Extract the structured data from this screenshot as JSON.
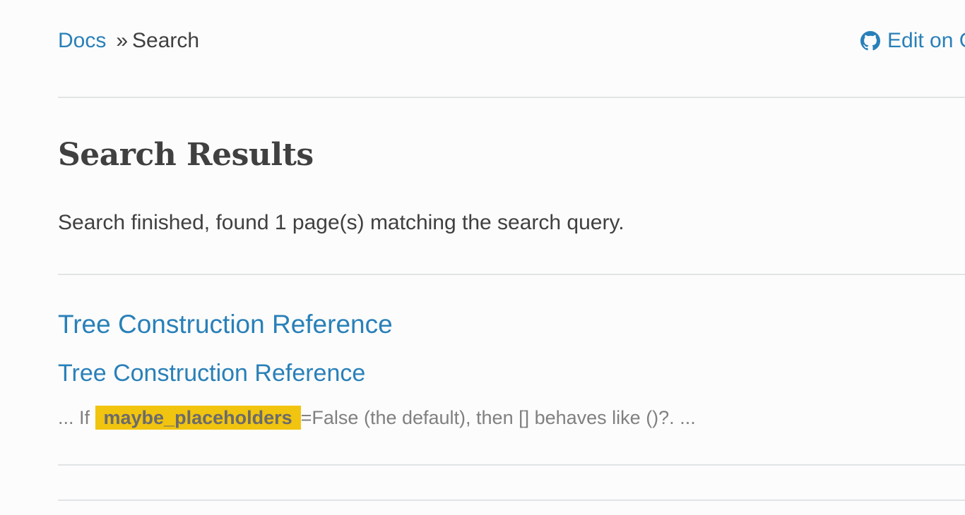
{
  "breadcrumb": {
    "root_label": "Docs",
    "separator": "»",
    "current": "Search"
  },
  "edit_link": {
    "label": "Edit on G",
    "icon": "github-icon"
  },
  "page": {
    "title": "Search Results",
    "summary": "Search finished, found 1 page(s) matching the search query."
  },
  "results": [
    {
      "title": "Tree Construction Reference",
      "section": "Tree Construction Reference",
      "context_before": "... If ",
      "highlight": "maybe_placeholders",
      "context_after": "=False (the default), then [] behaves like ()?. ..."
    }
  ],
  "colors": {
    "link": "#2980b9",
    "text": "#404040",
    "muted": "#808080",
    "highlight": "#f1c40f",
    "rule": "#e1e4e5",
    "background": "#fcfcfc"
  }
}
